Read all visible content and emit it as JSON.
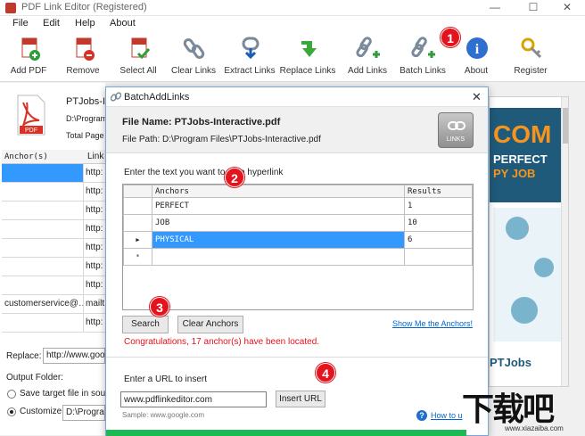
{
  "window": {
    "title": "PDF Link Editor (Registered)",
    "minimize": "—",
    "maximize": "☐",
    "close": "✕"
  },
  "menu": [
    "File",
    "Edit",
    "Help",
    "About"
  ],
  "toolbar": [
    {
      "label": "Add PDF",
      "icon": "add-pdf-icon"
    },
    {
      "label": "Remove",
      "icon": "remove-pdf-icon"
    },
    {
      "label": "Select All",
      "icon": "select-all-icon"
    },
    {
      "label": "Clear Links",
      "icon": "clear-links-icon"
    },
    {
      "label": "Extract Links",
      "icon": "extract-links-icon"
    },
    {
      "label": "Replace Links",
      "icon": "replace-links-icon"
    },
    {
      "label": "Add Links",
      "icon": "add-links-icon"
    },
    {
      "label": "Batch Links",
      "icon": "batch-links-icon"
    },
    {
      "label": "About",
      "icon": "about-icon"
    },
    {
      "label": "Register",
      "icon": "register-icon"
    }
  ],
  "file": {
    "name": "PTJobs-In",
    "path": "D:\\Program",
    "pages": "Total Page"
  },
  "links_grid": {
    "headers": [
      "Anchor(s)",
      "Link"
    ],
    "rows": [
      {
        "anchor": "",
        "link": "http:"
      },
      {
        "anchor": "",
        "link": "http:"
      },
      {
        "anchor": "",
        "link": "http:"
      },
      {
        "anchor": "",
        "link": "http:"
      },
      {
        "anchor": "",
        "link": "http:"
      },
      {
        "anchor": "",
        "link": "http:"
      },
      {
        "anchor": "",
        "link": "http:"
      },
      {
        "anchor": "customerservice@…",
        "link": "mailt"
      },
      {
        "anchor": "",
        "link": "http:"
      }
    ]
  },
  "replace": {
    "label": "Replace:",
    "value": "http://www.goo"
  },
  "output": {
    "label": "Output Folder:",
    "opt1": "Save target file in sourc",
    "opt2": "Customize:",
    "path": "D:\\Progran"
  },
  "preview": {
    "text1": "COM",
    "text2": "PERFECT",
    "text3": "PY JOB",
    "brand": "PTJobs"
  },
  "dialog": {
    "title": "BatchAddLinks",
    "close": "✕",
    "file_name_label": "File Name: PTJobs-Interactive.pdf",
    "file_path_label": "File Path: D:\\Program Files\\PTJobs-Interactive.pdf",
    "links_badge": "LINKS",
    "prompt": "Enter the text you want to    t a hyperlink",
    "table": {
      "headers": [
        "Anchors",
        "Results"
      ],
      "rows": [
        {
          "marker": "",
          "anchor": "PERFECT",
          "result": "1"
        },
        {
          "marker": "",
          "anchor": "JOB",
          "result": "10"
        },
        {
          "marker": "▶",
          "anchor": "PHYSICAL",
          "result": "6"
        },
        {
          "marker": "*",
          "anchor": "",
          "result": ""
        }
      ]
    },
    "search_button": "Search",
    "clear_button": "Clear Anchors",
    "show_link": "Show Me the Anchors!",
    "status": "Congratulations, 17 anchor(s) have been located.",
    "url_label": "Enter a URL to insert",
    "url_value": "www.pdflinkeditor.com",
    "insert_button": "Insert URL",
    "sample": "Sample: www.google.com",
    "help_link": "How to u"
  },
  "callouts": [
    "1",
    "2",
    "3",
    "4"
  ],
  "watermark": {
    "text": "下载吧",
    "url": "www.xiazaiba.com"
  },
  "colors": {
    "accent": "#3399ff",
    "red": "#e3141d",
    "link": "#0066cc",
    "status": "#e3141d"
  }
}
